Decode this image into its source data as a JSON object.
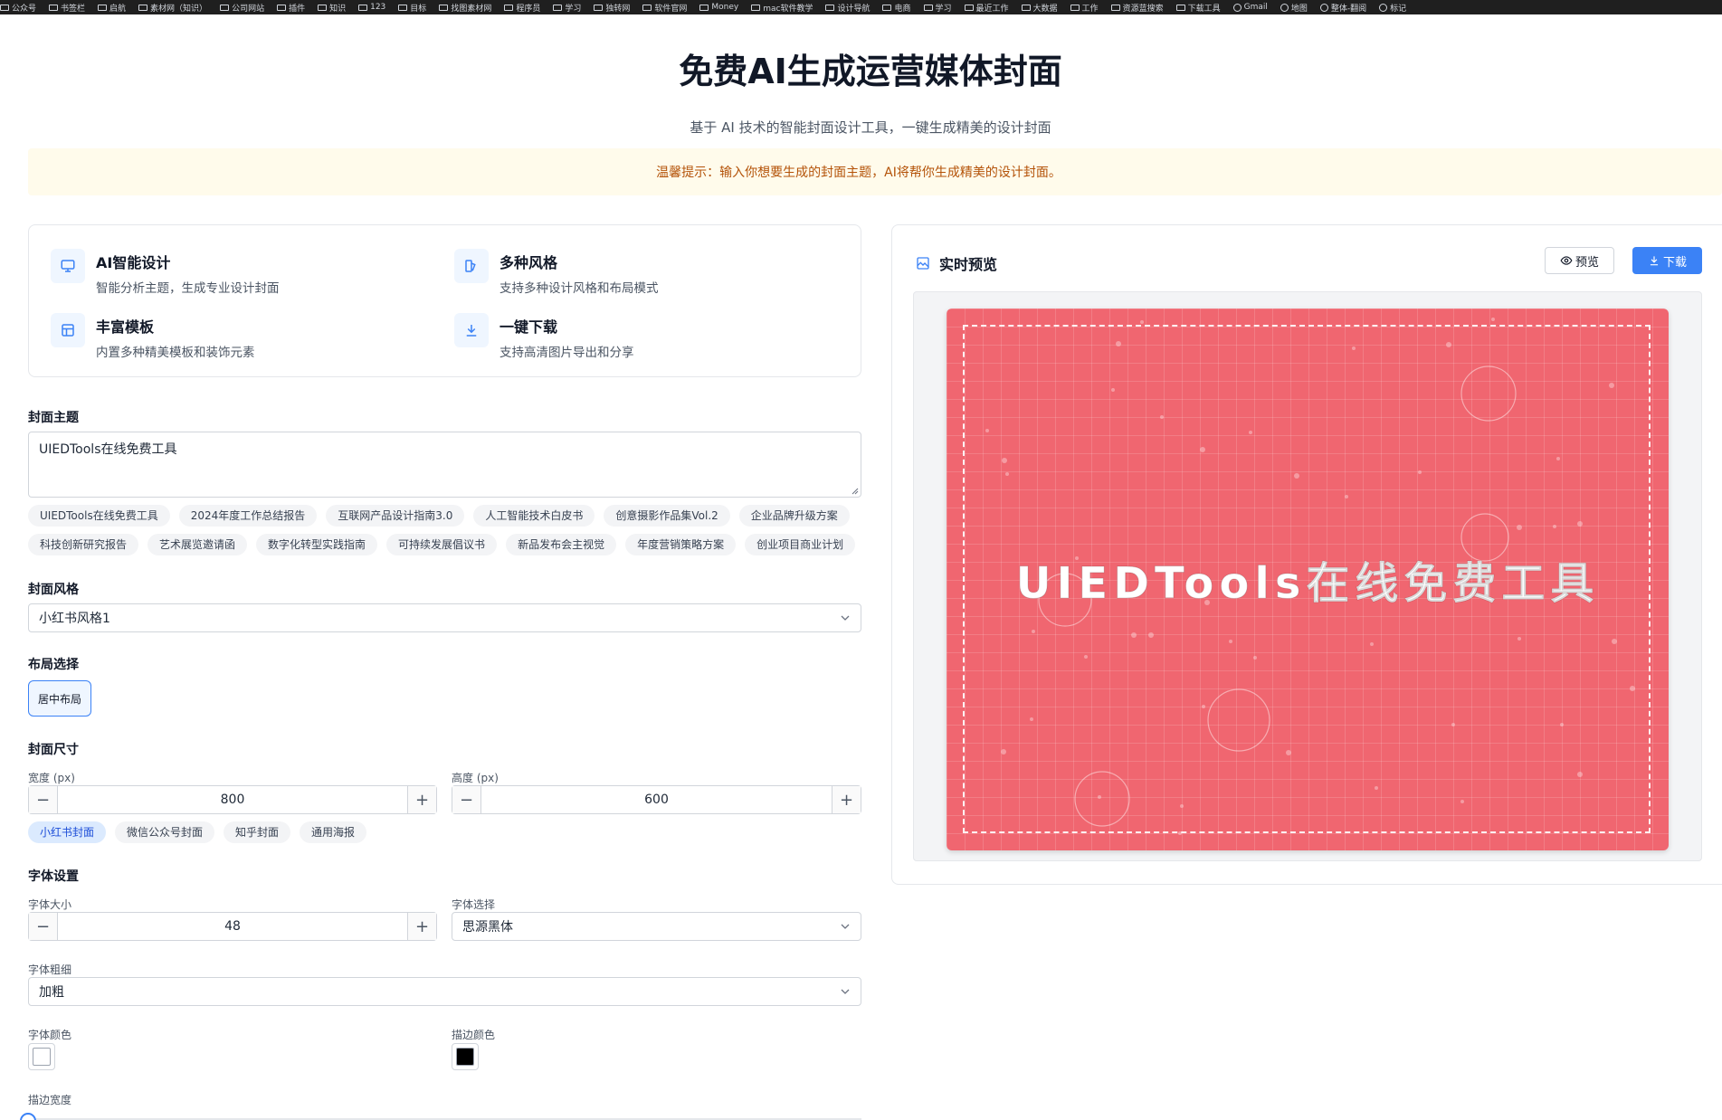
{
  "bookmarks": [
    "公众号",
    "书签栏",
    "启航",
    "素材网（知识）",
    "公司网站",
    "插件",
    "知识",
    "123",
    "目标",
    "找图素材网",
    "程序员",
    "学习",
    "独转网",
    "软件官网",
    "Money",
    "mac软件教学",
    "设计导航",
    "电商",
    "学习",
    "最近工作",
    "大数据",
    "工作",
    "资源蓝搜索",
    "下载工具",
    "Gmail",
    "地图",
    "整体-翻阅",
    "标记"
  ],
  "page": {
    "title": "免费AI生成运营媒体封面",
    "subtitle": "基于 AI 技术的智能封面设计工具，一键生成精美的设计封面",
    "notice": "温馨提示：输入你想要生成的封面主题，AI将帮你生成精美的设计封面。"
  },
  "features": [
    {
      "title": "AI智能设计",
      "desc": "智能分析主题，生成专业设计封面",
      "icon": "monitor-icon"
    },
    {
      "title": "多种风格",
      "desc": "支持多种设计风格和布局模式",
      "icon": "palette-icon"
    },
    {
      "title": "丰富模板",
      "desc": "内置多种精美模板和装饰元素",
      "icon": "template-icon"
    },
    {
      "title": "一键下载",
      "desc": "支持高清图片导出和分享",
      "icon": "download-icon"
    }
  ],
  "form": {
    "topic_label": "封面主题",
    "topic_value": "UIEDTools在线免费工具",
    "topic_suggestions_row1": [
      "UIEDTools在线免费工具",
      "2024年度工作总结报告",
      "互联网产品设计指南3.0",
      "人工智能技术白皮书",
      "创意摄影作品集Vol.2",
      "企业品牌升级方案"
    ],
    "topic_suggestions_row2": [
      "科技创新研究报告",
      "艺术展览邀请函",
      "数字化转型实践指南",
      "可持续发展倡议书",
      "新品发布会主视觉",
      "年度营销策略方案",
      "创业项目商业计划"
    ],
    "style_label": "封面风格",
    "style_value": "小红书风格1",
    "layout_label": "布局选择",
    "layout_option": "居中布局",
    "size_label": "封面尺寸",
    "width_label": "宽度 (px)",
    "width_value": "800",
    "height_label": "高度 (px)",
    "height_value": "600",
    "size_presets": [
      "小红书封面",
      "微信公众号封面",
      "知乎封面",
      "通用海报"
    ],
    "font_label": "字体设置",
    "font_size_label": "字体大小",
    "font_size_value": "48",
    "font_family_label": "字体选择",
    "font_family_value": "思源黑体",
    "font_weight_label": "字体粗细",
    "font_weight_value": "加粗",
    "font_color_label": "字体颜色",
    "font_color": "#ffffff",
    "stroke_color_label": "描边颜色",
    "stroke_color": "#000000",
    "stroke_width_label": "描边宽度",
    "stroke_width_fraction": 0.0
  },
  "preview": {
    "title": "实时预览",
    "preview_button": "预览",
    "download_button": "下载",
    "cover_text": "UIEDTools在线免费工具",
    "cover_color": "#f06670"
  },
  "colors": {
    "accent": "#3b82f6",
    "notice_bg": "#fffbeb",
    "notice_text": "#b45309"
  }
}
